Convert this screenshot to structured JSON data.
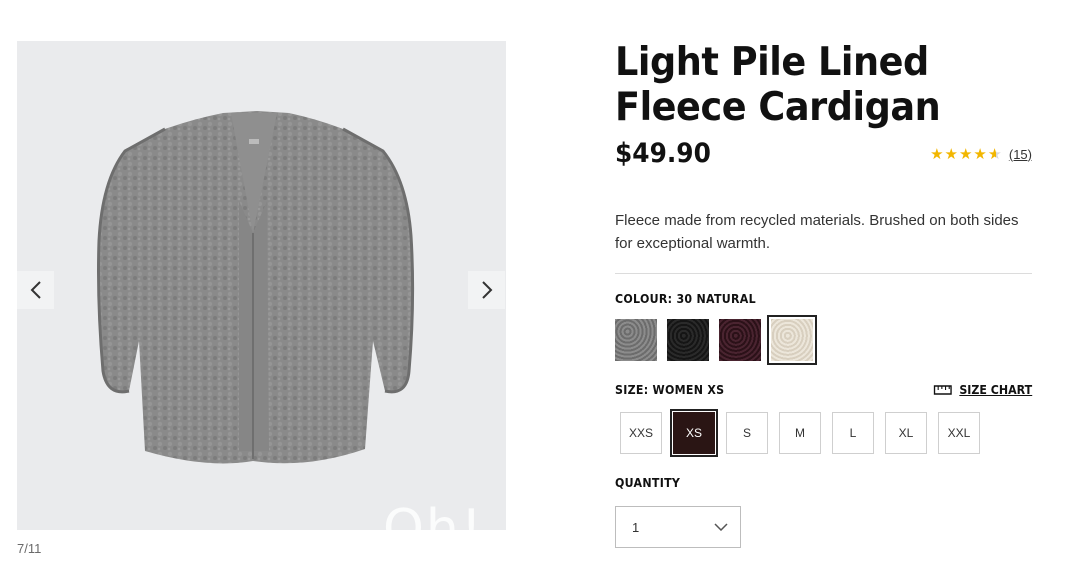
{
  "product": {
    "title": "Light Pile Lined Fleece Cardigan",
    "price": "$49.90",
    "rating_stars": 4.5,
    "review_count": "(15)",
    "description": "Fleece made from recycled materials. Brushed on both sides for exceptional warmth."
  },
  "gallery": {
    "counter": "7/11",
    "watermark": "Oh!",
    "prev_icon": "chevron-left-icon",
    "next_icon": "chevron-right-icon"
  },
  "colour": {
    "label": "COLOUR: 30 NATURAL",
    "swatches": [
      {
        "name": "grey",
        "color": "#7d7d7d"
      },
      {
        "name": "black",
        "color": "#202020"
      },
      {
        "name": "wine",
        "color": "#3b1a22"
      },
      {
        "name": "natural",
        "color": "#e6dfd2",
        "selected": true
      }
    ]
  },
  "size": {
    "label": "SIZE: WOMEN XS",
    "chart_label": "SIZE CHART",
    "chart_icon": "ruler-icon",
    "options": [
      "XXS",
      "XS",
      "S",
      "M",
      "L",
      "XL",
      "XXL"
    ],
    "selected": "XS"
  },
  "quantity": {
    "label": "QUANTITY",
    "value": "1",
    "icon": "chevron-down-icon"
  },
  "colors": {
    "star": "#f2b600",
    "selected_size_bg": "#2a1514"
  }
}
